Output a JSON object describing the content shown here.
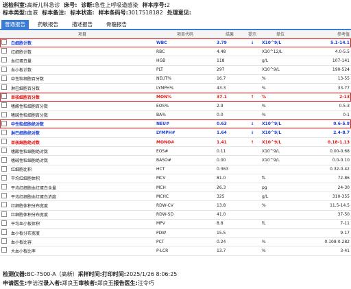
{
  "header": {
    "line1": [
      {
        "k": "送检科室:",
        "v": "高新儿科急诊"
      },
      {
        "k": "床号:",
        "v": ""
      },
      {
        "k": "诊断:",
        "v": "急性上呼吸道感染"
      },
      {
        "k": "样本序号:",
        "v": "2"
      }
    ],
    "line2": [
      {
        "k": "标本类型:",
        "v": "血液"
      },
      {
        "k": "标本备注:",
        "v": ""
      },
      {
        "k": "标本状态:",
        "v": ""
      },
      {
        "k": "样本条码号:",
        "v": "3017518182"
      },
      {
        "k": "处理意见:",
        "v": ""
      }
    ]
  },
  "tabs": [
    "普通报告",
    "药敏报告",
    "描述报告",
    "骨髓报告"
  ],
  "columns": [
    "项目",
    "项目代码",
    "结果",
    "提示",
    "单位",
    "参考值"
  ],
  "rows": [
    {
      "name": "白细胞计数",
      "code": "WBC",
      "result": "3.79",
      "flag": "↓",
      "unit": "X10^9/L",
      "ref": "5.1-14.1",
      "style": "blue",
      "hl": true
    },
    {
      "name": "红细胞计数",
      "code": "RBC",
      "result": "4.48",
      "flag": "",
      "unit": "X10^12/L",
      "ref": "4.0-5.5",
      "style": ""
    },
    {
      "name": "血红蛋白量",
      "code": "HGB",
      "result": "118",
      "flag": "",
      "unit": "g/L",
      "ref": "107-141",
      "style": ""
    },
    {
      "name": "血小板计数",
      "code": "PLT",
      "result": "297",
      "flag": "",
      "unit": "X10^9/L",
      "ref": "190-524",
      "style": ""
    },
    {
      "name": "中性粒细胞百分数",
      "code": "NEUT%",
      "result": "16.7",
      "flag": "",
      "unit": "%",
      "ref": "13-55",
      "style": ""
    },
    {
      "name": "淋巴细胞百分数",
      "code": "LYMPH%",
      "result": "43.3",
      "flag": "",
      "unit": "%",
      "ref": "33-77",
      "style": ""
    },
    {
      "name": "单核细胞百分数",
      "code": "MON%",
      "result": "37.1",
      "flag": "↑",
      "unit": "%",
      "ref": "2-13",
      "style": "red",
      "hl": true
    },
    {
      "name": "嗜酸性粒细胞百分数",
      "code": "EOS%",
      "result": "2.9",
      "flag": "",
      "unit": "%",
      "ref": "0.5-3",
      "style": ""
    },
    {
      "name": "嗜碱性粒细胞百分数",
      "code": "BA%",
      "result": "0.0",
      "flag": "",
      "unit": "%",
      "ref": "0-1",
      "style": ""
    },
    {
      "name": "中性粒细胞绝对数",
      "code": "NEU#",
      "result": "0.63",
      "flag": "↓",
      "unit": "X10^9/L",
      "ref": "0.6-5.8",
      "style": "blue",
      "hl": true
    },
    {
      "name": "淋巴细胞绝对数",
      "code": "LYMPH#",
      "result": "1.64",
      "flag": "↓",
      "unit": "X10^9/L",
      "ref": "2.4-8.7",
      "style": "blue"
    },
    {
      "name": "单核细胞绝对数",
      "code": "MONO#",
      "result": "1.41",
      "flag": "↑",
      "unit": "X10^9/L",
      "ref": "0.18-1.13",
      "style": "red"
    },
    {
      "name": "嗜酸性粒细胞绝对数",
      "code": "EOS#",
      "result": "0.11",
      "flag": "",
      "unit": "X10^9/L",
      "ref": "0.00-0.68",
      "style": ""
    },
    {
      "name": "嗜碱性粒细胞绝对数",
      "code": "BASO#",
      "result": "0.00",
      "flag": "",
      "unit": "X10^9/L",
      "ref": "0.0-0.10",
      "style": ""
    },
    {
      "name": "红细胞比积",
      "code": "HCT",
      "result": "0.363",
      "flag": "",
      "unit": "",
      "ref": "0.32-0.42",
      "style": ""
    },
    {
      "name": "平均红细胞体积",
      "code": "MCV",
      "result": "81.0",
      "flag": "",
      "unit": "fL",
      "ref": "72-86",
      "style": ""
    },
    {
      "name": "平均红细胞血红蛋白含量",
      "code": "MCH",
      "result": "26.3",
      "flag": "",
      "unit": "pg",
      "ref": "24-30",
      "style": ""
    },
    {
      "name": "平均红细胞血红蛋白浓度",
      "code": "MCHC",
      "result": "325",
      "flag": "",
      "unit": "g/L",
      "ref": "310-355",
      "style": ""
    },
    {
      "name": "红细胞体积分布宽度",
      "code": "RDW-CV",
      "result": "13.8",
      "flag": "",
      "unit": "%",
      "ref": "11.5-14.5",
      "style": ""
    },
    {
      "name": "红细胞体积分布宽度",
      "code": "RDW-SD",
      "result": "41.0",
      "flag": "",
      "unit": "",
      "ref": "37-50",
      "style": ""
    },
    {
      "name": "平均血小板体积",
      "code": "MPV",
      "result": "8.8",
      "flag": "",
      "unit": "fL",
      "ref": "7-11",
      "style": ""
    },
    {
      "name": "血小板分布宽度",
      "code": "PDW",
      "result": "15.5",
      "flag": "",
      "unit": "",
      "ref": "9-17",
      "style": ""
    },
    {
      "name": "血小板比容",
      "code": "PCT",
      "result": "0.24",
      "flag": "",
      "unit": "%",
      "ref": "0.108-0.282",
      "style": ""
    },
    {
      "name": "大血小板比率",
      "code": "P-LCR",
      "result": "13.7",
      "flag": "",
      "unit": "%",
      "ref": "3-41",
      "style": ""
    }
  ],
  "footer": {
    "line1": [
      {
        "k": "检测仪器:",
        "v": "BC-7500-A（高新）"
      },
      {
        "k": "采样时间:",
        "v": ""
      },
      {
        "k": "打印时间:",
        "v": "2025/1/26 8:06:25"
      }
    ],
    "line2": [
      {
        "k": "申请医生:",
        "v": "李洁滢"
      },
      {
        "k": "录入者:",
        "v": "郑良玉"
      },
      {
        "k": "审核者:",
        "v": "郑良玉"
      },
      {
        "k": "报告医生:",
        "v": "汪令巧"
      }
    ]
  }
}
